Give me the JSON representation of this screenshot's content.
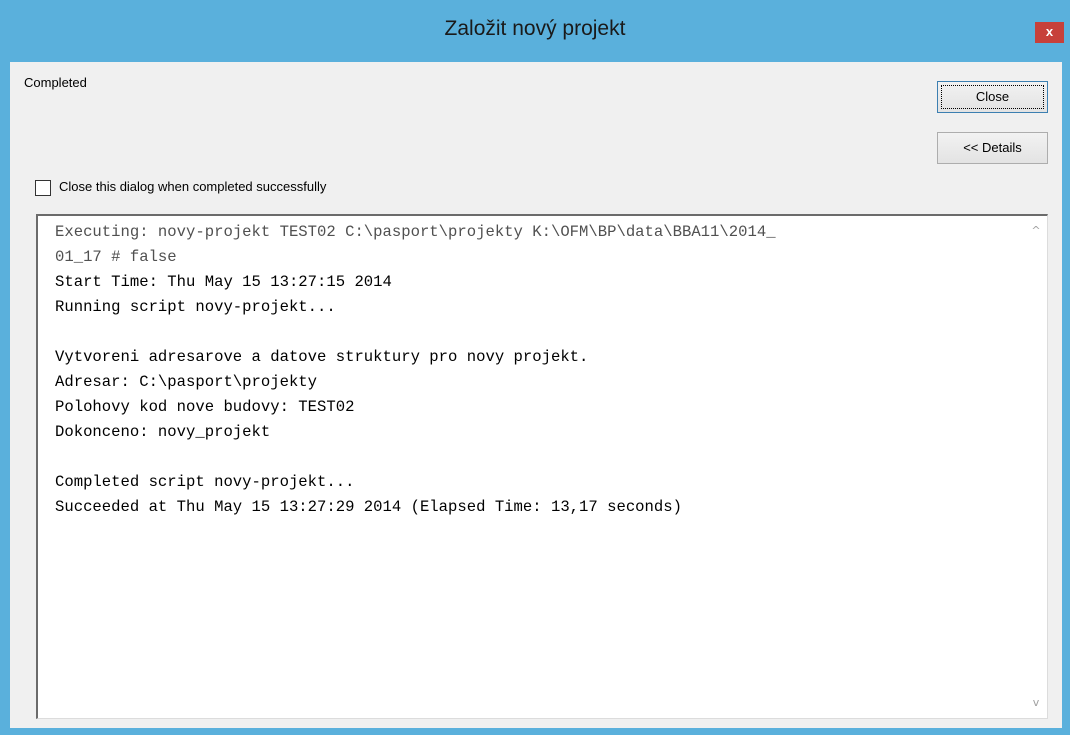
{
  "window": {
    "title": "Založit nový projekt",
    "close_glyph": "x",
    "accent_color": "#5ab0dc",
    "close_color": "#c7403a"
  },
  "status": {
    "text": "Completed"
  },
  "buttons": {
    "close_label": "Close",
    "details_label": "<< Details"
  },
  "option": {
    "checkbox_label": "Close this dialog when completed successfully",
    "checked": false
  },
  "log": {
    "lines": [
      "Executing: novy-projekt TEST02 C:\\pasport\\projekty K:\\OFM\\BP\\data\\BBA11\\2014_",
      "01_17 # false",
      "Start Time: Thu May 15 13:27:15 2014",
      "Running script novy-projekt...",
      "",
      "Vytvoreni adresarove a datove struktury pro novy projekt.",
      "Adresar: C:\\pasport\\projekty",
      "Polohovy kod nove budovy: TEST02",
      "Dokonceno: novy_projekt",
      "",
      "Completed script novy-projekt...",
      "Succeeded at Thu May 15 13:27:29 2014 (Elapsed Time: 13,17 seconds)"
    ]
  },
  "scrollbar": {
    "up_glyph": "^",
    "down_glyph": "v"
  }
}
